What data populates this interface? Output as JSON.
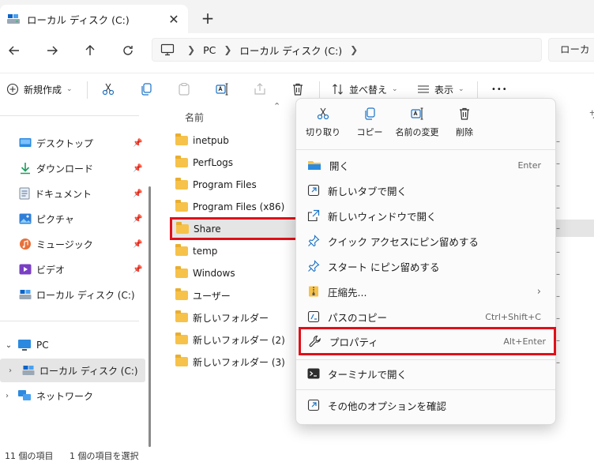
{
  "window": {
    "tab_title": "ローカル ディスク (C:)",
    "close_glyph": "✕",
    "new_tab_glyph": "+"
  },
  "address": {
    "crumbs": [
      "PC",
      "ローカル ディスク (C:)"
    ],
    "search_placeholder": "ローカ"
  },
  "toolbar": {
    "new_label": "新規作成",
    "sort_label": "並べ替え",
    "view_label": "表示",
    "more_glyph": "•••"
  },
  "sidebar": {
    "quick_access": [
      {
        "label": "デスクトップ",
        "icon": "desktop-icon"
      },
      {
        "label": "ダウンロード",
        "icon": "download-icon"
      },
      {
        "label": "ドキュメント",
        "icon": "document-icon"
      },
      {
        "label": "ピクチャ",
        "icon": "picture-icon"
      },
      {
        "label": "ミュージック",
        "icon": "music-icon"
      },
      {
        "label": "ビデオ",
        "icon": "video-icon"
      },
      {
        "label": "ローカル ディスク (C:)",
        "icon": "drive-icon"
      }
    ],
    "pc_label": "PC",
    "drive_label": "ローカル ディスク (C:)",
    "network_label": "ネットワーク"
  },
  "files": {
    "column_name": "名前",
    "items": [
      "inetpub",
      "PerfLogs",
      "Program Files",
      "Program Files (x86)",
      "Share",
      "temp",
      "Windows",
      "ユーザー",
      "新しいフォルダー",
      "新しいフォルダー (2)",
      "新しいフォルダー (3)"
    ],
    "selected": "Share"
  },
  "context_menu": {
    "quick_actions": {
      "cut": "切り取り",
      "copy": "コピー",
      "rename": "名前の変更",
      "delete": "削除"
    },
    "items": {
      "open": {
        "label": "開く",
        "shortcut": "Enter"
      },
      "open_new_tab": {
        "label": "新しいタブで開く"
      },
      "open_new_window": {
        "label": "新しいウィンドウで開く"
      },
      "pin_quick_access": {
        "label": "クイック アクセスにピン留めする"
      },
      "pin_start": {
        "label": "スタート にピン留めする"
      },
      "compress": {
        "label": "圧縮先..."
      },
      "copy_path": {
        "label": "パスのコピー",
        "shortcut": "Ctrl+Shift+C"
      },
      "properties": {
        "label": "プロパティ",
        "shortcut": "Alt+Enter"
      },
      "open_terminal": {
        "label": "ターミナルで開く"
      },
      "more_options": {
        "label": "その他のオプションを確認"
      }
    }
  },
  "right_column": {
    "header": "サ"
  },
  "status": {
    "item_count": "11 個の項目",
    "selection": "1 個の項目を選択"
  },
  "colors": {
    "highlight_border": "#e0101a",
    "selection_bg": "#e5e5e5",
    "folder": "#f6c24a",
    "accent": "#1a73c8"
  }
}
